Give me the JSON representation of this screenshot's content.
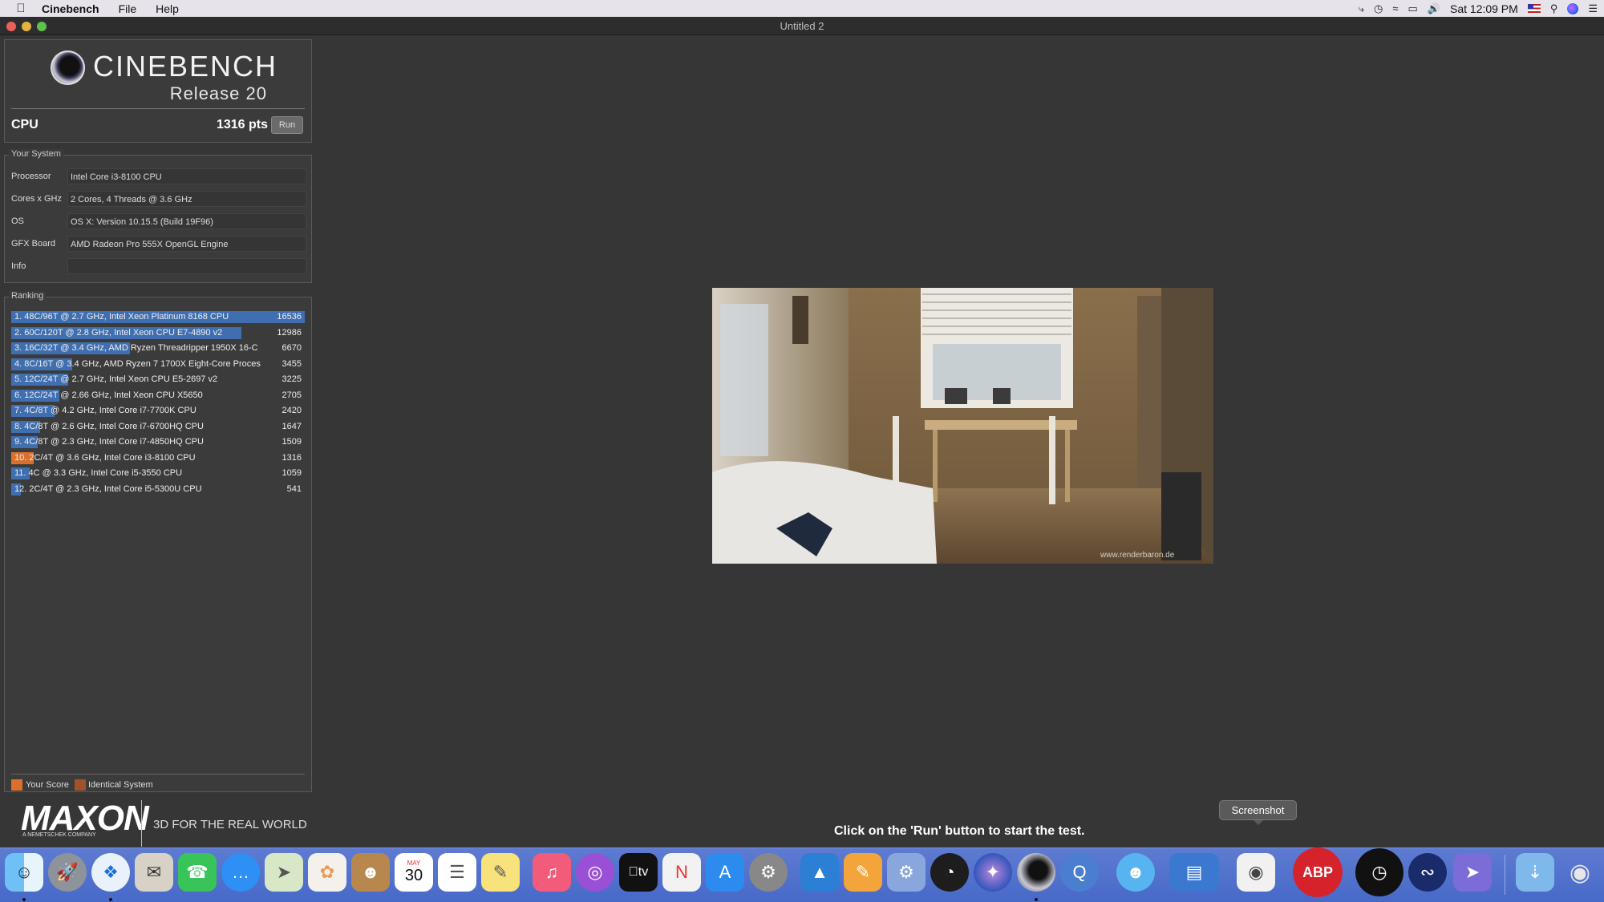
{
  "menubar": {
    "app_name": "Cinebench",
    "menus": [
      "File",
      "Help"
    ],
    "clock": "Sat 12:09 PM"
  },
  "window": {
    "title": "Untitled 2"
  },
  "header": {
    "product": "CINEBENCH",
    "release": "Release 20",
    "cpu_label": "CPU",
    "cpu_score": "1316 pts",
    "run_label": "Run"
  },
  "system": {
    "title": "Your System",
    "rows": [
      {
        "key": "Processor",
        "value": "Intel Core i3-8100 CPU"
      },
      {
        "key": "Cores x GHz",
        "value": "2 Cores, 4 Threads @ 3.6 GHz"
      },
      {
        "key": "OS",
        "value": "OS X: Version 10.15.5 (Build 19F96)"
      },
      {
        "key": "GFX Board",
        "value": "AMD Radeon Pro 555X OpenGL Engine"
      },
      {
        "key": "Info",
        "value": ""
      }
    ]
  },
  "ranking": {
    "title": "Ranking",
    "max_score": 16536,
    "rows": [
      {
        "label": "1. 48C/96T @ 2.7 GHz, Intel Xeon Platinum 8168 CPU",
        "score": "16536",
        "value": 16536,
        "mine": false
      },
      {
        "label": "2. 60C/120T @ 2.8 GHz, Intel Xeon CPU E7-4890 v2",
        "score": "12986",
        "value": 12986,
        "mine": false
      },
      {
        "label": "3. 16C/32T @ 3.4 GHz, AMD Ryzen Threadripper 1950X 16-C",
        "score": "6670",
        "value": 6670,
        "mine": false
      },
      {
        "label": "4. 8C/16T @ 3.4 GHz, AMD Ryzen 7 1700X Eight-Core Proces",
        "score": "3455",
        "value": 3455,
        "mine": false
      },
      {
        "label": "5. 12C/24T @ 2.7 GHz, Intel Xeon CPU E5-2697 v2",
        "score": "3225",
        "value": 3225,
        "mine": false
      },
      {
        "label": "6. 12C/24T @ 2.66 GHz, Intel Xeon CPU X5650",
        "score": "2705",
        "value": 2705,
        "mine": false
      },
      {
        "label": "7. 4C/8T @ 4.2 GHz, Intel Core i7-7700K CPU",
        "score": "2420",
        "value": 2420,
        "mine": false
      },
      {
        "label": "8. 4C/8T @ 2.6 GHz, Intel Core i7-6700HQ CPU",
        "score": "1647",
        "value": 1647,
        "mine": false
      },
      {
        "label": "9. 4C/8T @ 2.3 GHz, Intel Core i7-4850HQ CPU",
        "score": "1509",
        "value": 1509,
        "mine": false
      },
      {
        "label": "10. 2C/4T @ 3.6 GHz, Intel Core i3-8100 CPU",
        "score": "1316",
        "value": 1316,
        "mine": true
      },
      {
        "label": "11. 4C @ 3.3 GHz, Intel Core i5-3550 CPU",
        "score": "1059",
        "value": 1059,
        "mine": false
      },
      {
        "label": "12. 2C/4T @ 2.3 GHz, Intel Core i5-5300U CPU",
        "score": "541",
        "value": 541,
        "mine": false
      }
    ],
    "legend": {
      "your_score": "Your Score",
      "identical": "Identical System"
    },
    "colors": {
      "bar": "#3f6fb0",
      "your_score": "#d9702b",
      "identical": "#a0522d"
    }
  },
  "branding": {
    "maxon": "MAXON",
    "maxon_sub": "A NEMETSCHEK COMPANY",
    "tagline": "3D FOR THE REAL WORLD"
  },
  "render": {
    "watermark": "www.renderbaron.de"
  },
  "instruction": "Click on the 'Run' button to start the test.",
  "tooltip": "Screenshot",
  "dock": {
    "calendar_month": "MAY",
    "calendar_day": "30",
    "adblock_label": "ABP",
    "tv_label": "tv"
  }
}
